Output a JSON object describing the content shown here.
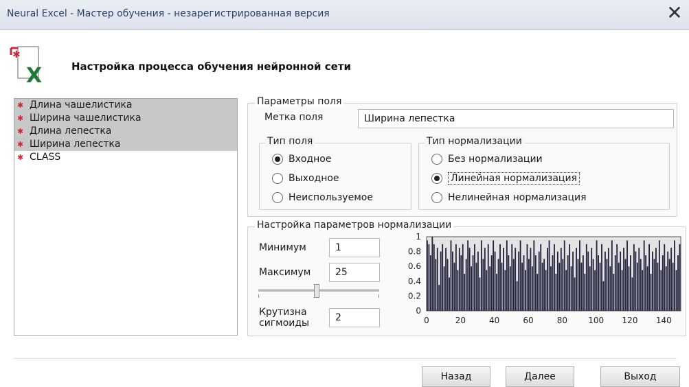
{
  "window": {
    "title": "Neural Excel - Мастер обучения - незарегистрированная версия",
    "close_icon": "close-icon"
  },
  "header": {
    "title": "Настройка процесса обучения нейронной сети",
    "icon": "neural-excel-logo-icon"
  },
  "fields_list": [
    {
      "label": "Длина чашелистика",
      "selected": true
    },
    {
      "label": "Ширина чашелистика",
      "selected": true
    },
    {
      "label": "Длина лепестка",
      "selected": true
    },
    {
      "label": "Ширина лепестка",
      "selected": true
    },
    {
      "label": "CLASS",
      "selected": false
    }
  ],
  "field_params": {
    "group_title": "Параметры поля",
    "label_caption": "Метка поля",
    "label_value": "Ширина лепестка"
  },
  "field_type": {
    "group_title": "Тип поля",
    "options": [
      {
        "label": "Входное",
        "checked": true
      },
      {
        "label": "Выходное",
        "checked": false
      },
      {
        "label": "Неиспользуемое",
        "checked": false
      }
    ]
  },
  "normalization_type": {
    "group_title": "Тип нормализации",
    "options": [
      {
        "label": "Без нормализации",
        "checked": false
      },
      {
        "label": "Линейная нормализация",
        "checked": true
      },
      {
        "label": "Нелинейная нормализация",
        "checked": false
      }
    ]
  },
  "normalization_settings": {
    "group_title": "Настройка параметров нормализации",
    "min_label": "Минимум",
    "min_value": "1",
    "max_label": "Максимум",
    "max_value": "25",
    "slider_value": 0.48,
    "sigmoid_label_1": "Крутизна",
    "sigmoid_label_2": "сигмоиды",
    "sigmoid_value": "2"
  },
  "chart_data": {
    "type": "bar",
    "y_ticks": [
      "1",
      "0.8",
      "0.6",
      "0.4",
      "0.2",
      "0"
    ],
    "x_ticks": [
      "0",
      "20",
      "40",
      "60",
      "80",
      "100",
      "120",
      "140"
    ],
    "xlim": [
      0,
      150
    ],
    "ylim": [
      0,
      1
    ],
    "bar_color": "#252540",
    "values": [
      0.95,
      0.9,
      0.75,
      1,
      0.9,
      0.7,
      0.85,
      0.35,
      0.8,
      0.9,
      0.6,
      0.85,
      0.7,
      0.45,
      0.95,
      0.8,
      0.65,
      0.9,
      0.55,
      0.85,
      0.75,
      0.9,
      0.5,
      0.7,
      0.95,
      0.85,
      0.6,
      0.75,
      0.9,
      0.65,
      0.8,
      0.45,
      0.95,
      0.7,
      0.85,
      0.55,
      0.9,
      0.6,
      0.75,
      0.95,
      0.8,
      0.5,
      0.7,
      0.9,
      0.65,
      0.85,
      0.55,
      0.95,
      0.75,
      0.6,
      0.9,
      0.7,
      0.85,
      0.4,
      0.8,
      0.95,
      0.65,
      0.75,
      0.55,
      0.9,
      0.7,
      0.85,
      0.6,
      0.95,
      0.75,
      0.5,
      0.8,
      0.9,
      0.65,
      0.7,
      0.55,
      0.85,
      0.95,
      0.6,
      0.75,
      0.9,
      0.5,
      0.8,
      0.65,
      0.85,
      0.7,
      0.95,
      0.55,
      0.75,
      0.9,
      0.6,
      0.8,
      0.45,
      0.85,
      0.7,
      0.95,
      0.65,
      0.75,
      0.5,
      0.9,
      0.8,
      0.6,
      0.85,
      0.7,
      0.55,
      0.95,
      0.75,
      0.65,
      0.9,
      0.4,
      0.8,
      0.7,
      0.85,
      0.6,
      0.95,
      0.5,
      0.75,
      0.9,
      0.65,
      0.8,
      0.55,
      0.85,
      0.7,
      0.95,
      0.6,
      0.75,
      0.45,
      0.9,
      0.8,
      0.65,
      0.85,
      0.7,
      0.55,
      0.95,
      0.75,
      0.6,
      0.9,
      0.5,
      0.8,
      0.7,
      0.85,
      0.65,
      0.95,
      0.55,
      0.75,
      0.9,
      0.6,
      0.8,
      0.7,
      0.85,
      0.65,
      0.95,
      0.55,
      0.75,
      0.9
    ]
  },
  "buttons": {
    "back": "Назад",
    "next": "Далее",
    "exit": "Выход"
  }
}
